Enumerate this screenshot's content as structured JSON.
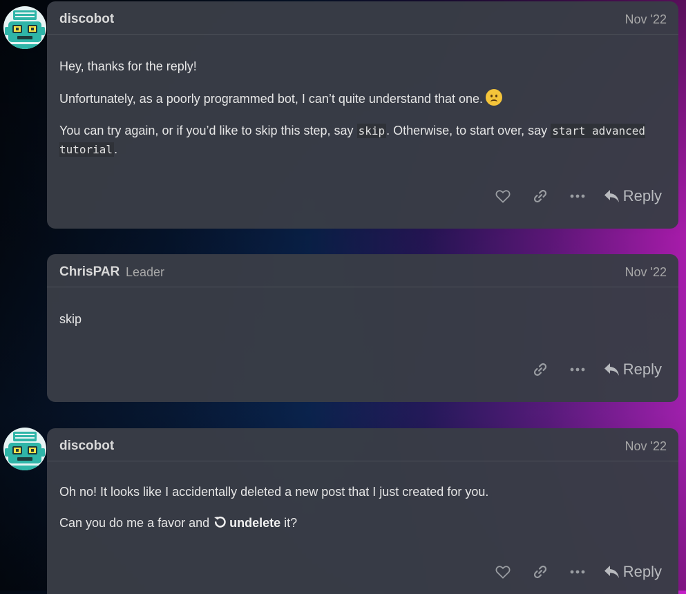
{
  "posts": [
    {
      "username": "discobot",
      "date": "Nov '22",
      "paragraphs": {
        "p1": "Hey, thanks for the reply!",
        "p2": "Unfortunately, as a poorly programmed bot, I can’t quite understand that one.",
        "p3_pre": "You can try again, or if you’d like to skip this step, say ",
        "p3_code1": "skip",
        "p3_mid": ". Otherwise, to start over, say ",
        "p3_code2": "start advanced tutorial",
        "p3_end": "."
      },
      "reply_label": "Reply"
    },
    {
      "username": "ChrisPAR",
      "user_title": "Leader",
      "date": "Nov '22",
      "paragraphs": {
        "p1": "skip"
      },
      "reply_label": "Reply"
    },
    {
      "username": "discobot",
      "date": "Nov '22",
      "paragraphs": {
        "p1": "Oh no! It looks like I accidentally deleted a new post that I just created for you.",
        "p2_pre": "Can you do me a favor and ",
        "p2_bold": "undelete",
        "p2_end": " it?"
      },
      "reply_label": "Reply"
    }
  ],
  "icons": {
    "like": "heart-icon",
    "share": "link-icon",
    "more": "ellipsis-icon",
    "reply": "reply-arrow-icon",
    "emoji": "slightly-frowning-face-icon",
    "undelete": "undo-icon"
  },
  "colors": {
    "post_bg": "#393d46",
    "text": "#e6e6e6",
    "muted": "#a8a8a8",
    "avatar_teal": "#2fb5a8"
  }
}
